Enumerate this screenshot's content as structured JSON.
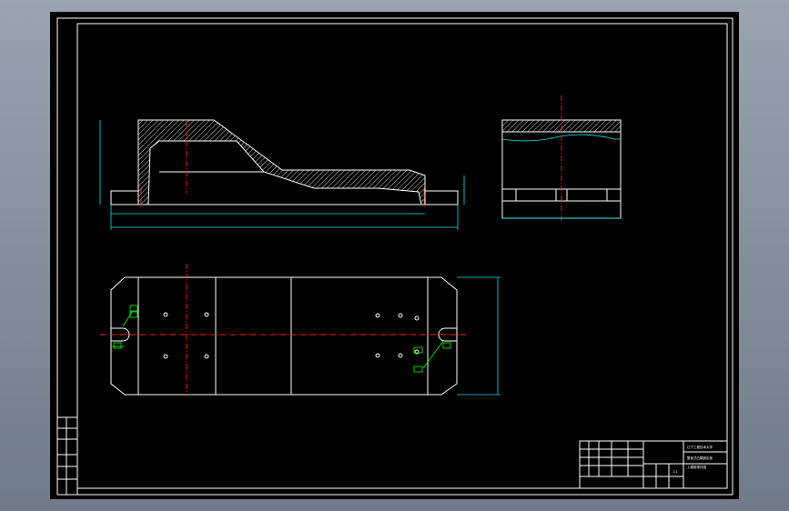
{
  "drawing": {
    "background_color": "#000000",
    "line_color": "#ffffff",
    "dimension_color": "#00e6e6",
    "centerline_color": "#ff2020",
    "callout_color": "#00ff00"
  },
  "title_block": {
    "school": "辽宁工程技术大学",
    "drawing_name_line1": "整体式凸模固定板",
    "drawing_name_line2": "上模座零件图",
    "scale": "1:1"
  }
}
